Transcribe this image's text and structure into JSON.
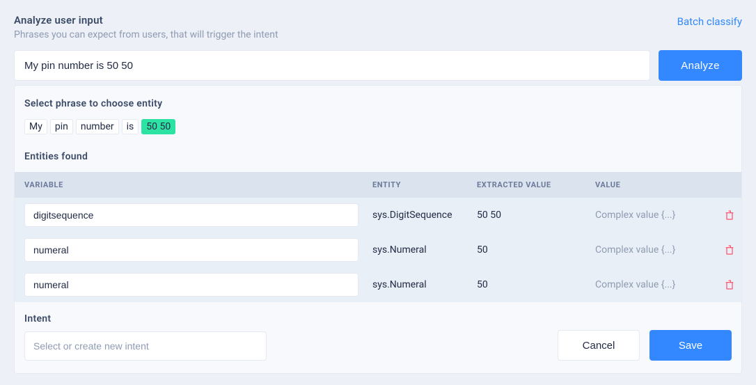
{
  "header": {
    "title": "Analyze user input",
    "subtitle": "Phrases you can expect from users, that will trigger the intent",
    "batch_link": "Batch classify"
  },
  "input": {
    "value": "My pin number is 50 50",
    "analyze_label": "Analyze"
  },
  "phrase": {
    "title": "Select phrase to choose entity",
    "tokens": [
      {
        "text": "My",
        "highlight": false
      },
      {
        "text": "pin",
        "highlight": false
      },
      {
        "text": "number",
        "highlight": false
      },
      {
        "text": "is",
        "highlight": false
      },
      {
        "text": "50 50",
        "highlight": true
      }
    ]
  },
  "entities": {
    "title": "Entities found",
    "columns": {
      "variable": "VARIABLE",
      "entity": "ENTITY",
      "extracted": "EXTRACTED VALUE",
      "value": "VALUE"
    },
    "rows": [
      {
        "variable": "digitsequence",
        "entity": "sys.DigitSequence",
        "extracted": "50 50",
        "value": "Complex value {...}"
      },
      {
        "variable": "numeral",
        "entity": "sys.Numeral",
        "extracted": "50",
        "value": "Complex value {...}"
      },
      {
        "variable": "numeral",
        "entity": "sys.Numeral",
        "extracted": "50",
        "value": "Complex value {...}"
      }
    ]
  },
  "intent": {
    "label": "Intent",
    "placeholder": "Select or create new intent",
    "cancel_label": "Cancel",
    "save_label": "Save"
  }
}
